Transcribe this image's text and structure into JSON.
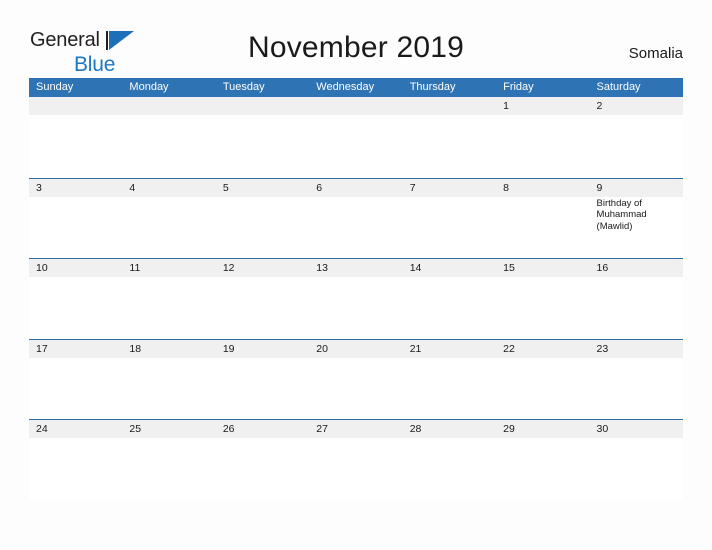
{
  "brand": {
    "name_part1": "General",
    "name_part2": "Blue",
    "flag_icon": "flag-triangle-icon"
  },
  "header": {
    "title": "November 2019",
    "country": "Somalia"
  },
  "calendar": {
    "weekdays": [
      "Sunday",
      "Monday",
      "Tuesday",
      "Wednesday",
      "Thursday",
      "Friday",
      "Saturday"
    ],
    "weeks": [
      {
        "days": [
          {
            "number": "",
            "events": []
          },
          {
            "number": "",
            "events": []
          },
          {
            "number": "",
            "events": []
          },
          {
            "number": "",
            "events": []
          },
          {
            "number": "",
            "events": []
          },
          {
            "number": "1",
            "events": []
          },
          {
            "number": "2",
            "events": []
          }
        ]
      },
      {
        "days": [
          {
            "number": "3",
            "events": []
          },
          {
            "number": "4",
            "events": []
          },
          {
            "number": "5",
            "events": []
          },
          {
            "number": "6",
            "events": []
          },
          {
            "number": "7",
            "events": []
          },
          {
            "number": "8",
            "events": []
          },
          {
            "number": "9",
            "events": [
              "Birthday of Muhammad (Mawlid)"
            ]
          }
        ]
      },
      {
        "days": [
          {
            "number": "10",
            "events": []
          },
          {
            "number": "11",
            "events": []
          },
          {
            "number": "12",
            "events": []
          },
          {
            "number": "13",
            "events": []
          },
          {
            "number": "14",
            "events": []
          },
          {
            "number": "15",
            "events": []
          },
          {
            "number": "16",
            "events": []
          }
        ]
      },
      {
        "days": [
          {
            "number": "17",
            "events": []
          },
          {
            "number": "18",
            "events": []
          },
          {
            "number": "19",
            "events": []
          },
          {
            "number": "20",
            "events": []
          },
          {
            "number": "21",
            "events": []
          },
          {
            "number": "22",
            "events": []
          },
          {
            "number": "23",
            "events": []
          }
        ]
      },
      {
        "days": [
          {
            "number": "24",
            "events": []
          },
          {
            "number": "25",
            "events": []
          },
          {
            "number": "26",
            "events": []
          },
          {
            "number": "27",
            "events": []
          },
          {
            "number": "28",
            "events": []
          },
          {
            "number": "29",
            "events": []
          },
          {
            "number": "30",
            "events": []
          }
        ]
      }
    ]
  },
  "colors": {
    "header_blue": "#2e74b5",
    "row_border_blue": "#2e6da4",
    "date_band_gray": "#f0f0f0",
    "brand_blue": "#1d78c2",
    "text_dark": "#1a1a1a",
    "page_background": "#fdfdfd"
  }
}
